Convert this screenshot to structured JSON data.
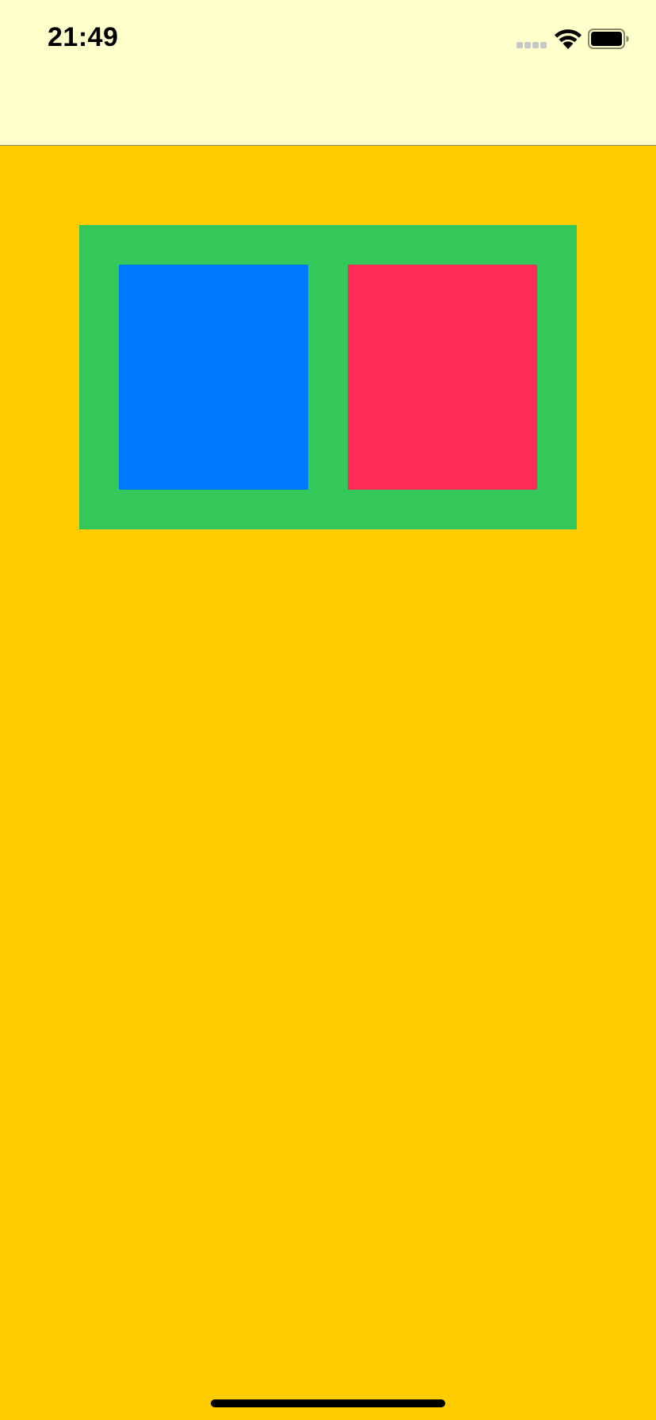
{
  "status_bar": {
    "time": "21:49",
    "signal_icon": "cellular-signal-icon",
    "wifi_icon": "wifi-icon",
    "battery_icon": "battery-icon",
    "battery_level": 1.0
  },
  "colors": {
    "nav_background": "#FFFFCC",
    "page_background": "#FFCC00",
    "container": "#34C759",
    "left_tile": "#007AFF",
    "right_tile": "#FF2D55",
    "home_indicator": "#000000"
  }
}
